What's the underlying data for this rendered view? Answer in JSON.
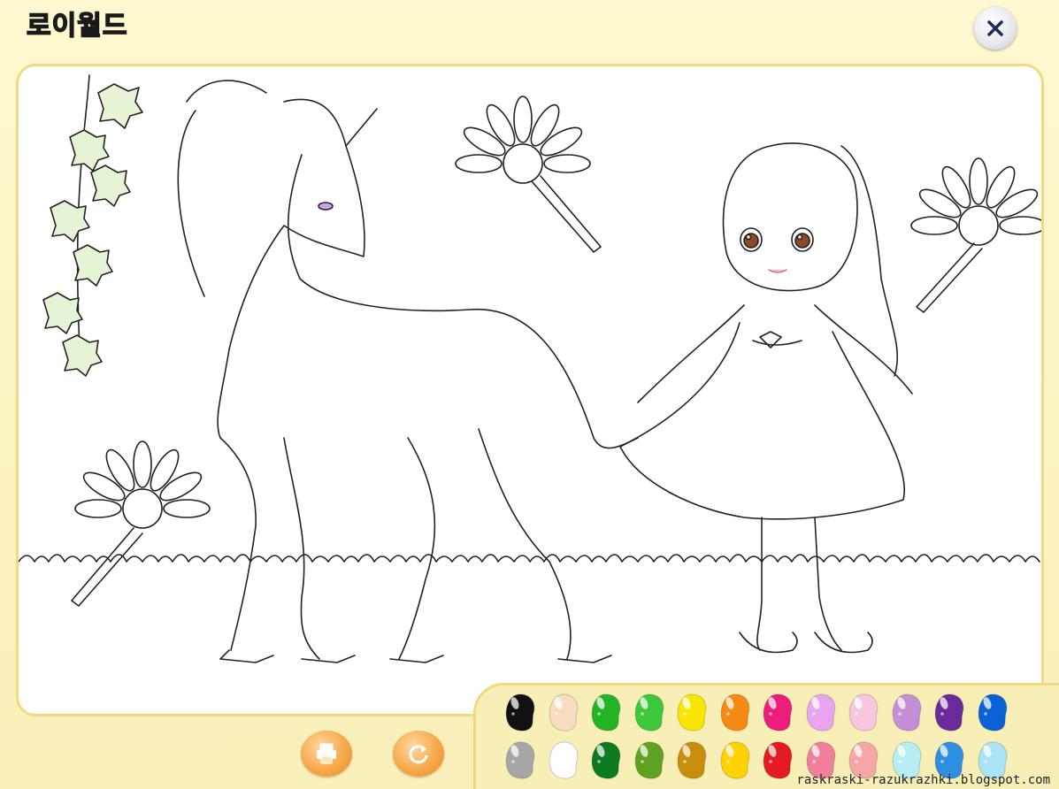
{
  "app": {
    "logo_text": [
      "로",
      "이",
      "월",
      "드"
    ]
  },
  "toolbar": {
    "close_icon": "close-icon",
    "print_icon": "printer-icon",
    "reset_icon": "refresh-icon"
  },
  "palette": {
    "row1": [
      "#111111",
      "#f7ddc0",
      "#23b424",
      "#3cc83a",
      "#f9e600",
      "#f48a12",
      "#ee1c7b",
      "#e9a4ee",
      "#f8c6e0",
      "#c58fd8",
      "#6b2a9a",
      "#0a62d6"
    ],
    "row2": [
      "#a6a6a6",
      "#ffffff",
      "#0d7a22",
      "#5fa222",
      "#c98d0c",
      "#ffd200",
      "#e41b22",
      "#f07f9a",
      "#f6a6a6",
      "#b6eef3",
      "#2e8ee0",
      "#a9e3f4"
    ]
  },
  "footer": {
    "watermark": "raskraski-razukrazhki.blogspot.com"
  }
}
